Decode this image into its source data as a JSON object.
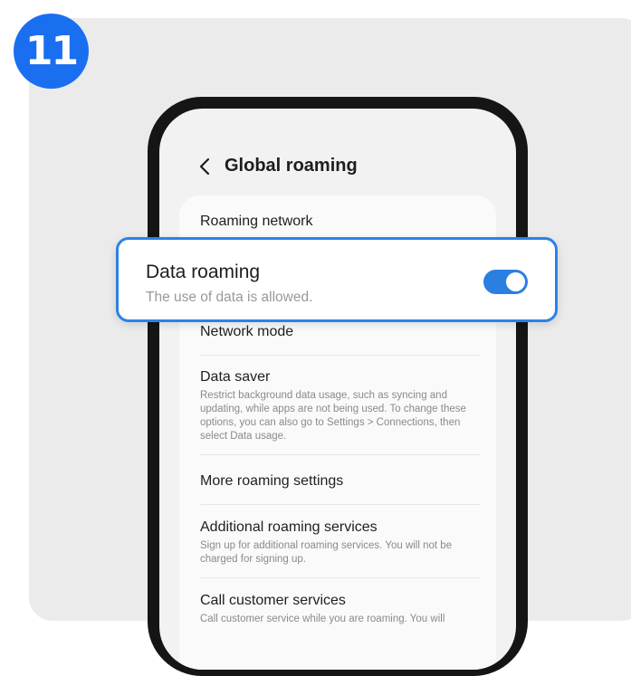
{
  "step_number": "11",
  "screen": {
    "title": "Global roaming",
    "items": [
      {
        "title": "Roaming network",
        "description": ""
      },
      {
        "title": "Network mode",
        "description": ""
      },
      {
        "title": "Data saver",
        "description": "Restrict background data usage, such as syncing and updating, while apps are not being used. To change these options, you can also go to Settings > Connections, then select Data usage."
      },
      {
        "title": "More roaming settings",
        "description": ""
      },
      {
        "title": "Additional roaming services",
        "description": "Sign up for additional roaming services. You will not be charged for signing up."
      },
      {
        "title": "Call customer services",
        "description": "Call customer service while you are roaming. You will"
      }
    ]
  },
  "highlight": {
    "title": "Data roaming",
    "description": "The use of data is allowed.",
    "toggle_on": true
  },
  "colors": {
    "accent": "#2b82e8",
    "badge": "#1a6ff0"
  },
  "icons": {
    "back": "chevron-left-icon"
  }
}
